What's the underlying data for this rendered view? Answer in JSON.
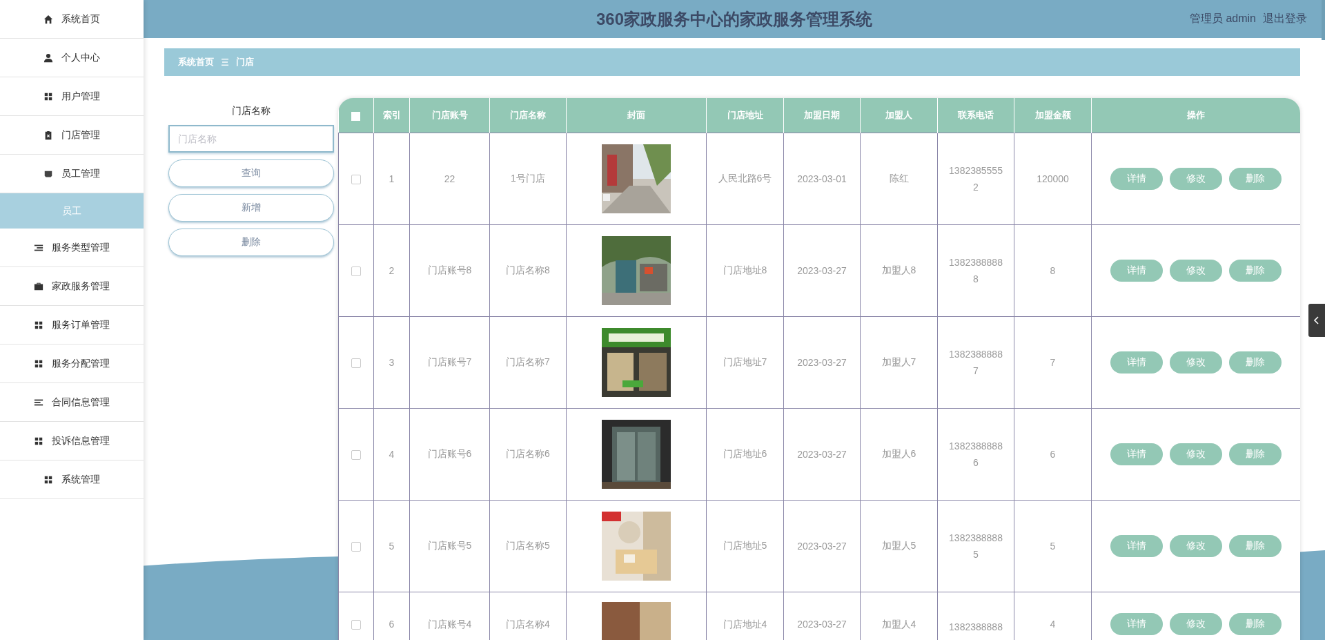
{
  "sidebar": {
    "items": [
      {
        "label": "系统首页",
        "selected": false
      },
      {
        "label": "个人中心",
        "selected": false
      },
      {
        "label": "用户管理",
        "selected": false
      },
      {
        "label": "门店管理",
        "selected": false
      },
      {
        "label": "员工管理",
        "selected": false,
        "children": [
          {
            "label": "员工",
            "selected": true
          }
        ]
      },
      {
        "label": "服务类型管理",
        "selected": false
      },
      {
        "label": "家政服务管理",
        "selected": false
      },
      {
        "label": "服务订单管理",
        "selected": false
      },
      {
        "label": "服务分配管理",
        "selected": false
      },
      {
        "label": "合同信息管理",
        "selected": false
      },
      {
        "label": "投诉信息管理",
        "selected": false
      },
      {
        "label": "系统管理",
        "selected": false
      }
    ]
  },
  "header": {
    "title": "360家政服务中心的家政服务管理系统",
    "user": "管理员 admin",
    "logout": "退出登录"
  },
  "breadcrumb": [
    "系统首页",
    "门店"
  ],
  "search": {
    "label": "门店名称",
    "placeholder": "门店名称",
    "buttons": [
      "查询",
      "新增",
      "删除"
    ]
  },
  "table": {
    "columns": [
      "索引",
      "门店账号",
      "门店名称",
      "封面",
      "门店地址",
      "加盟日期",
      "加盟人",
      "联系电话",
      "加盟金额",
      "操作"
    ],
    "select_all": {
      "checked": false
    },
    "rows": [
      {
        "checked": false,
        "index": "1",
        "account": "22",
        "name": "1号门店",
        "address": "人民北路6号",
        "date": "2023-03-01",
        "franchisee": "陈红",
        "phone": "13823855552",
        "amount": "120000",
        "actions": [
          "详情",
          "修改",
          "删除"
        ]
      },
      {
        "checked": false,
        "index": "2",
        "account": "门店账号8",
        "name": "门店名称8",
        "address": "门店地址8",
        "date": "2023-03-27",
        "franchisee": "加盟人8",
        "phone": "13823888888",
        "amount": "8",
        "actions": [
          "详情",
          "修改",
          "删除"
        ]
      },
      {
        "checked": false,
        "index": "3",
        "account": "门店账号7",
        "name": "门店名称7",
        "address": "门店地址7",
        "date": "2023-03-27",
        "franchisee": "加盟人7",
        "phone": "13823888887",
        "amount": "7",
        "actions": [
          "详情",
          "修改",
          "删除"
        ]
      },
      {
        "checked": false,
        "index": "4",
        "account": "门店账号6",
        "name": "门店名称6",
        "address": "门店地址6",
        "date": "2023-03-27",
        "franchisee": "加盟人6",
        "phone": "13823888886",
        "amount": "6",
        "actions": [
          "详情",
          "修改",
          "删除"
        ]
      },
      {
        "checked": false,
        "index": "5",
        "account": "门店账号5",
        "name": "门店名称5",
        "address": "门店地址5",
        "date": "2023-03-27",
        "franchisee": "加盟人5",
        "phone": "13823888885",
        "amount": "5",
        "actions": [
          "详情",
          "修改",
          "删除"
        ]
      },
      {
        "checked": false,
        "index": "6",
        "account": "门店账号4",
        "name": "门店名称4",
        "address": "门店地址4",
        "date": "2023-03-27",
        "franchisee": "加盟人4",
        "phone": "1382388888",
        "amount": "4",
        "actions": [
          "详情",
          "修改",
          "删除"
        ]
      }
    ]
  }
}
